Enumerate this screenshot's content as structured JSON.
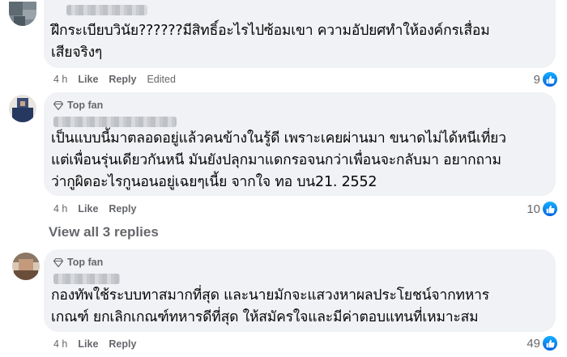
{
  "comments": [
    {
      "author_redacted": true,
      "badge": "",
      "lines": [
        "ฝึกระเบียบวินัย??????มีสิทธิ์อะไรไปซ้อมเขา ความอัปยศทำให้องค์กรเสื่อม",
        "เสียจริงๆ"
      ],
      "time": "4 h",
      "like_label": "Like",
      "reply_label": "Reply",
      "edited_label": "Edited",
      "reaction_count": "9"
    },
    {
      "author_redacted": true,
      "badge": "Top fan",
      "lines": [
        "เป็นแบบนี้มาตลอดอยู่แล้วคนข้างในรู้ดี เพราะเคยผ่านมา ขนาดไม่ได้หนีเที่ยว",
        "แต่เพื่อนรุ่นเดียวกันหนี มันยังปลุกมาแดกรอจนกว่าเพื่อนจะกลับมา อยากถาม",
        "ว่ากูผิดอะไรกูนอนอยู่เฉยๆเนี้ย จากใจ ทอ บน21. 2552"
      ],
      "time": "4 h",
      "like_label": "Like",
      "reply_label": "Reply",
      "reaction_count": "10",
      "view_replies": "View all 3 replies"
    },
    {
      "author_redacted": true,
      "badge": "Top fan",
      "lines": [
        "กองทัพใช้ระบบทาสมากที่สุด และนายมักจะแสวงหาผลประโยชน์จากทหาร",
        "เกณฑ์ ยกเลิกเกณฑ์ทหารดีที่สุด ให้สมัครใจและมีค่าตอบแทนที่เหมาะสม"
      ],
      "time": "4 h",
      "like_label": "Like",
      "reply_label": "Reply",
      "reaction_count": "49"
    }
  ],
  "colors": {
    "bubble": "#f0f2f5",
    "meta_text": "#65676b",
    "like_blue": "#0866ff"
  },
  "icons": {
    "badge": "diamond-icon",
    "reaction": "thumbs-up-icon"
  }
}
